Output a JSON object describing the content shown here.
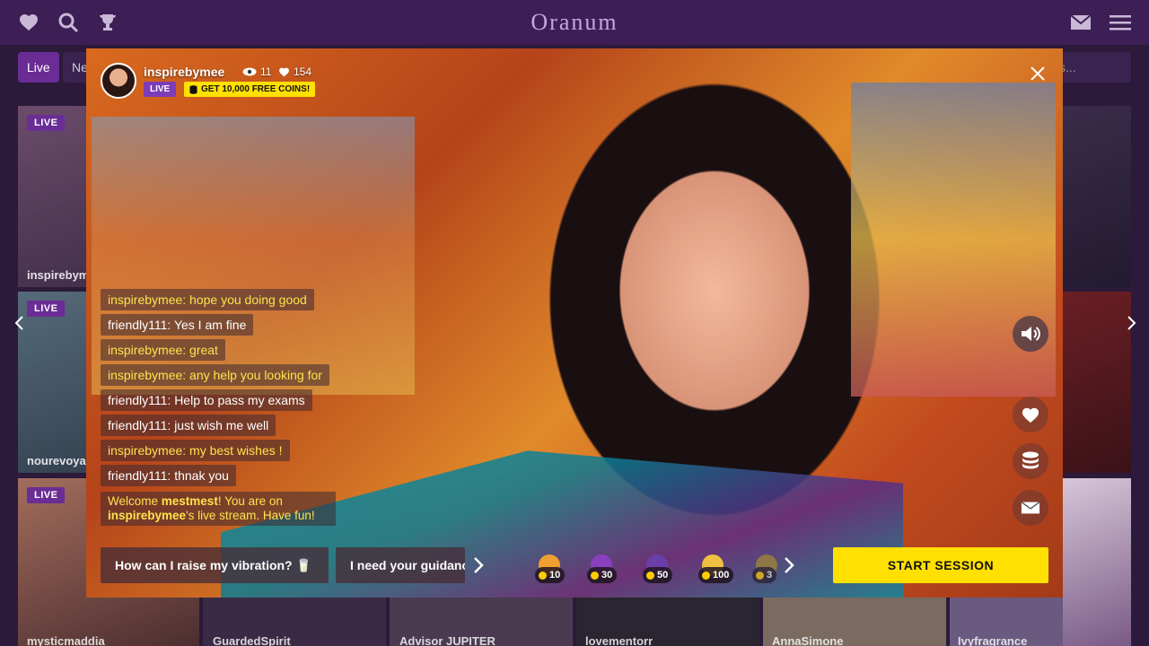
{
  "app": {
    "logo": "Oranum"
  },
  "filters": {
    "live": "Live",
    "new": "Ne",
    "search": "s..."
  },
  "tiles": [
    {
      "name": "inspirebym",
      "live": "LIVE"
    },
    {
      "name": "nourevoya",
      "live": "LIVE"
    },
    {
      "name": "",
      "live": "LIVE"
    }
  ],
  "bottom_names": [
    "mysticmaddia",
    "GuardedSpirit",
    "Advisor JUPITER",
    "lovementorr",
    "AnnaSimone",
    "Ivyfragrance"
  ],
  "stream": {
    "username": "inspirebymee",
    "viewers": "11",
    "likes": "154",
    "live_badge": "LIVE",
    "coins_promo": "GET 10,000 FREE COINS!"
  },
  "chat": [
    {
      "text": "inspirebymee: hope you doing good",
      "from": "streamer"
    },
    {
      "text": "friendly111: Yes I am fine",
      "from": "user"
    },
    {
      "text": "inspirebymee: great",
      "from": "streamer"
    },
    {
      "text": "inspirebymee: any help you looking for",
      "from": "streamer"
    },
    {
      "text": "friendly111: Help to pass my exams",
      "from": "user"
    },
    {
      "text": "friendly111: just wish me well",
      "from": "user"
    },
    {
      "text": "inspirebymee: my best wishes !",
      "from": "streamer"
    },
    {
      "text": "friendly111: thnak you",
      "from": "user"
    }
  ],
  "welcome": {
    "prefix": "Welcome ",
    "user": "mestmest",
    "middle": "! You are on ",
    "streamer": "inspirebymee",
    "suffix": "'s live stream. Have fun!"
  },
  "questions": [
    "How can I raise my vibration? 🥛",
    "I need your guidance"
  ],
  "tips": [
    {
      "amount": "10",
      "color": "#f0a030"
    },
    {
      "amount": "30",
      "color": "#8a3fc0"
    },
    {
      "amount": "50",
      "color": "#6a3fa8"
    },
    {
      "amount": "100",
      "color": "#f0c040"
    },
    {
      "amount": "3",
      "color": "#a88a30"
    }
  ],
  "start_session": "START SESSION",
  "icons": {
    "favorite": "heart-icon",
    "search": "search-icon",
    "trophy": "trophy-icon",
    "mail": "mail-icon",
    "menu": "hamburger-icon",
    "close": "close-icon",
    "sound": "speaker-icon",
    "coins": "coins-icon"
  },
  "colors": {
    "topbar": "#3e1f55",
    "accent": "#6a2d95",
    "cta": "#ffe000",
    "streamer_chat": "#ffe34d"
  }
}
